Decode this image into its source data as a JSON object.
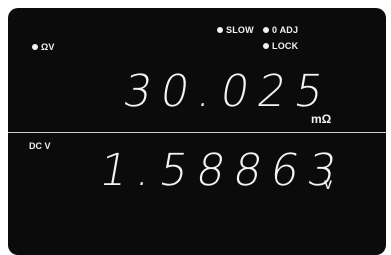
{
  "indicators": {
    "ohm_v": "ΩV",
    "slow": "SLOW",
    "zero_adj": "0 ADJ",
    "lock": "LOCK"
  },
  "primary": {
    "value": "30.025",
    "unit": "mΩ"
  },
  "secondary": {
    "function": "DC V",
    "value": "1.58863",
    "unit": "V"
  },
  "colors": {
    "display_background": "#0b0b0b",
    "segment": "#f4f4f4"
  }
}
